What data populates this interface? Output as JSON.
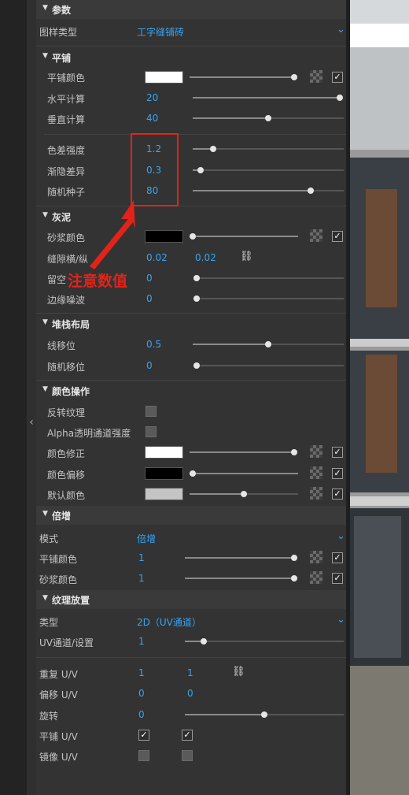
{
  "sections": {
    "params": "参数",
    "tiling": "平铺",
    "mortar": "灰泥",
    "stacking": "堆栈布局",
    "color_ops": "颜色操作",
    "multiply": "倍增",
    "texture_placement": "纹理放置"
  },
  "pattern": {
    "label": "图样类型",
    "value": "工字缝铺砖"
  },
  "tiling": {
    "color_label": "平铺颜色",
    "color": "#ffffff",
    "color_slider": 0.97,
    "h_count_label": "水平计算",
    "h_count": "20",
    "h_slider": 1.0,
    "v_count_label": "垂直计算",
    "v_count": "40",
    "v_slider": 0.5,
    "color_var_label": "色差强度",
    "color_var": "1.2",
    "color_var_slider": 0.13,
    "fade_var_label": "渐隐差异",
    "fade_var": "0.3",
    "fade_var_slider": 0.05,
    "seed_label": "随机种子",
    "seed": "80",
    "seed_slider": 0.79
  },
  "mortar": {
    "color_label": "砂浆颜色",
    "color": "#000000",
    "color_slider": 0.02,
    "gap_label": "缝隙横/纵",
    "gap_h": "0.02",
    "gap_v": "0.02",
    "hole_label": "留空",
    "hole": "0",
    "hole_slider": 0.02,
    "edge_label": "边缘噪波",
    "edge": "0",
    "edge_slider": 0.02
  },
  "stacking": {
    "line_shift_label": "线移位",
    "line_shift": "0.5",
    "line_shift_slider": 0.5,
    "random_shift_label": "随机移位",
    "random_shift": "0",
    "random_shift_slider": 0.02
  },
  "color_ops": {
    "invert_label": "反转纹理",
    "alpha_label": "Alpha透明通道强度",
    "correction_label": "颜色修正",
    "correction_color": "#ffffff",
    "correction_slider": 0.97,
    "offset_label": "颜色偏移",
    "offset_color": "#000000",
    "offset_slider": 0.02,
    "default_label": "默认颜色",
    "default_color": "#c4c4c4",
    "default_slider": 0.5
  },
  "multiply": {
    "mode_label": "模式",
    "mode_value": "倍增",
    "tile_label": "平铺颜色",
    "tile_value": "1",
    "tile_slider": 1.0,
    "mortar_label": "砂浆颜色",
    "mortar_value": "1",
    "mortar_slider": 1.0
  },
  "texture": {
    "type_label": "类型",
    "type_value": "2D（UV通道）",
    "uv_label": "UV通道/设置",
    "uv_value": "1",
    "uv_slider": 0.1,
    "repeat_label": "重复 U/V",
    "repeat_u": "1",
    "repeat_v": "1",
    "offset_label": "偏移 U/V",
    "offset_u": "0",
    "offset_v": "0",
    "rotate_label": "旋转",
    "rotate": "0",
    "rotate_slider": 0.5,
    "tile_label": "平铺 U/V",
    "mirror_label": "镜像 U/V"
  },
  "annotation": {
    "text": "注意数值",
    "color": "#e2231a"
  }
}
